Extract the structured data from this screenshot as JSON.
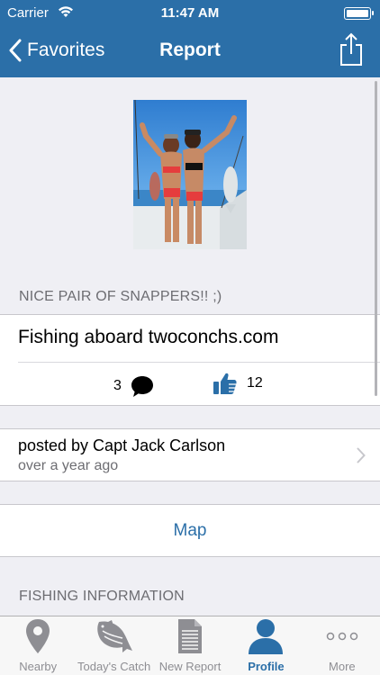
{
  "status_bar": {
    "carrier": "Carrier",
    "time": "11:47 AM"
  },
  "nav": {
    "back_label": "Favorites",
    "title": "Report"
  },
  "report": {
    "headline": "NICE PAIR OF SNAPPERS!! ;)",
    "title": "Fishing aboard twoconchs.com",
    "comments_count": "3",
    "likes_count": "12",
    "posted_by": "posted by Capt Jack Carlson",
    "posted_time": "over a year ago",
    "map_label": "Map",
    "fishing_info_header": "FISHING INFORMATION"
  },
  "tabs": [
    {
      "label": "Nearby",
      "icon": "map-pin-icon",
      "active": false
    },
    {
      "label": "Today's Catch",
      "icon": "fish-icon",
      "active": false
    },
    {
      "label": "New Report",
      "icon": "document-icon",
      "active": false
    },
    {
      "label": "Profile",
      "icon": "person-icon",
      "active": true
    },
    {
      "label": "More",
      "icon": "more-dots-icon",
      "active": false
    }
  ],
  "colors": {
    "nav_bar": "#2b6fa8",
    "accent": "#2b6fa8",
    "background": "#efeff4",
    "secondary_text": "#6d6d72"
  }
}
